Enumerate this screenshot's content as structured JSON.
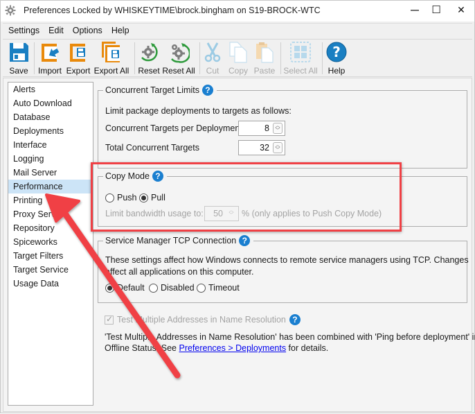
{
  "window": {
    "title": "Preferences Locked by WHISKEYTIME\\brock.bingham on S19-BROCK-WTC",
    "controls": {
      "minimize": "—",
      "maximize": "☐",
      "close": "✕"
    }
  },
  "menu": [
    "Settings",
    "Edit",
    "Options",
    "Help"
  ],
  "toolbar": {
    "buttons": [
      {
        "label": "Save",
        "icon": "floppy-disk-icon",
        "enabled": true
      },
      {
        "label": "Import",
        "icon": "import-icon",
        "enabled": true
      },
      {
        "label": "Export",
        "icon": "export-icon",
        "enabled": true
      },
      {
        "label": "Export All",
        "icon": "export-all-icon",
        "enabled": true
      },
      {
        "label": "Reset",
        "icon": "reset-gear-icon",
        "enabled": true
      },
      {
        "label": "Reset All",
        "icon": "reset-all-gears-icon",
        "enabled": true
      },
      {
        "label": "Cut",
        "icon": "scissors-icon",
        "enabled": false
      },
      {
        "label": "Copy",
        "icon": "copy-icon",
        "enabled": false
      },
      {
        "label": "Paste",
        "icon": "paste-icon",
        "enabled": false
      },
      {
        "label": "Select All",
        "icon": "select-all-icon",
        "enabled": false
      },
      {
        "label": "Help",
        "icon": "help-icon",
        "enabled": true
      }
    ]
  },
  "nav": {
    "selected": "Performance",
    "items": [
      "Alerts",
      "Auto Download",
      "Database",
      "Deployments",
      "Interface",
      "Logging",
      "Mail Server",
      "Performance",
      "Printing",
      "Proxy Server",
      "Repository",
      "Spiceworks",
      "Target Filters",
      "Target Service",
      "Usage Data"
    ]
  },
  "concurrent": {
    "title": "Concurrent Target Limits",
    "description": "Limit package deployments to targets as follows:",
    "per_deployment_label": "Concurrent Targets per Deployment",
    "per_deployment_value": "8",
    "total_label": "Total Concurrent Targets",
    "total_value": "32"
  },
  "copy_mode": {
    "title": "Copy Mode",
    "options": [
      "Push",
      "Pull"
    ],
    "selected": "Pull",
    "bandwidth_label": "Limit bandwidth usage to:",
    "bandwidth_value": "50",
    "bandwidth_suffix": "% (only applies to Push Copy Mode)"
  },
  "tcp": {
    "title": "Service Manager TCP Connection",
    "description_line1": "These settings affect how Windows connects to remote service managers using TCP. Changes",
    "description_line2": "affect all applications on this computer.",
    "options": [
      "Default",
      "Disabled",
      "Timeout"
    ],
    "selected": "Default"
  },
  "name_resolution": {
    "checkbox_label": "Test Multiple Addresses in Name Resolution",
    "checked": true,
    "note_line1": "'Test Multiple Addresses in Name Resolution' has been combined with 'Ping before deployment' in",
    "note_line2_prefix": "Offline Status. See ",
    "note_link": "Preferences > Deployments",
    "note_line2_suffix": " for details."
  },
  "annotation": {
    "highlight_color": "#f04045",
    "arrow_color": "#f04045"
  },
  "help_glyph": "?"
}
